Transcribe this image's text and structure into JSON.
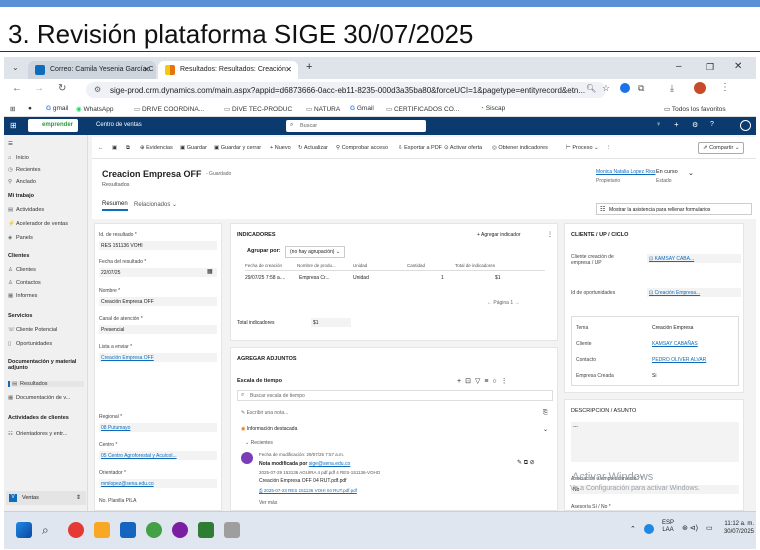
{
  "slide_title": "3. Revisión plataforma SIGE 30/07/2025",
  "browser": {
    "tabs": [
      {
        "label": "Correo: Camila Yesenia García C",
        "active": false
      },
      {
        "label": "Resultados: Resultados: Creación",
        "active": true
      }
    ],
    "new_tab": "+",
    "url": "sige-prod.crm.dynamics.com/main.aspx?appid=d6873666-0acc-eb11-8235-000d3a35ba80&forceUCI=1&pagetype=entityrecord&etn...",
    "bookmarks": [
      "gmail",
      "WhatsApp",
      "DRIVE COORDINA...",
      "DIVE TEC-PRODUC",
      "NATURA",
      "Gmail",
      "CERTIFICADOS CO...",
      "Siscap"
    ],
    "bookmarks_right": "Todos los favoritos"
  },
  "app": {
    "brand": "emprender",
    "area": "Centro de ventas",
    "search_placeholder": "Buscar"
  },
  "nav": {
    "top": [
      "Inicio",
      "Recientes",
      "Anclado"
    ],
    "section_work": "Mi trabajo",
    "work_items": [
      "Actividades",
      "Acelerador de ventas",
      "Panels"
    ],
    "section_clients": "Clientes",
    "client_items": [
      "Clientes",
      "Contactos",
      "Informes"
    ],
    "section_services": "Servicios",
    "service_items": [
      "Cliente Potencial",
      "Oportunidades"
    ],
    "section_docs": "Documentación y material adjunto",
    "doc_items": [
      "Resultados",
      "Documentación de v..."
    ],
    "section_activities": "Actividades de clientes",
    "activity_items": [
      "Orientadores y entr..."
    ],
    "area_switcher": "Ventas"
  },
  "commands": [
    "Evidencias",
    "Guardar",
    "Guardar y cerrar",
    "Nuevo",
    "Actualizar",
    "Comprobar acceso",
    "Exportar a PDF",
    "Activar oferta",
    "Obtener indicadores",
    "Proceso",
    "Compartir"
  ],
  "record": {
    "title": "Creacion Empresa OFF",
    "saved": "- Guardado",
    "entity": "Resultados",
    "tabs": [
      "Resumen",
      "Relacionados"
    ],
    "owner_name": "Monica Natalia Lopez Rios",
    "owner_label": "Propietario",
    "status": "En curso",
    "status_label": "Estado",
    "assist": "Mostrar la asistencia para rellenar formularios"
  },
  "form_left": {
    "fields": [
      {
        "label": "Id. de resultado *",
        "value": "RES 151136 VOHI"
      },
      {
        "label": "Fecha del resultado *",
        "value": "22/07/25"
      },
      {
        "label": "Nombre *",
        "value": "Creación Empresa OFF"
      },
      {
        "label": "Canal de atención *",
        "value": "Presencial"
      },
      {
        "label": "Lista a enviar *",
        "value": "Creación Empresa OFF"
      },
      {
        "label": "Regional *",
        "value": "08 Putumayo"
      },
      {
        "label": "Centro *",
        "value": "05 Centro Agroforestal y Acuícol..."
      },
      {
        "label": "Orientador *",
        "value": "mmlopez@sena.edu.co"
      },
      {
        "label": "No. Planilla PILA",
        "value": ""
      }
    ]
  },
  "indicators": {
    "title": "INDICADORES",
    "add": "Agregar indicador",
    "group_label": "Agrupar por:",
    "group_value": "(no hay agrupación)",
    "columns": [
      "Fecha de creación",
      "Nombre de produ...",
      "Unidad",
      "Cantidad",
      "Total de indicadores"
    ],
    "row": {
      "date": "29/07/25 7:58 a....",
      "name": "Empresa Cr...",
      "unit": "Unidad",
      "qty": "1",
      "total": "$1"
    },
    "pager": "Página 1",
    "total_label": "Total indicadores",
    "total_value": "$1"
  },
  "attachments": {
    "title": "AGREGAR ADJUNTOS",
    "timeline": "Escala de tiempo",
    "search": "Buscar escala de tiempo",
    "note_placeholder": "Escribir una nota...",
    "highlight": "Información destacada",
    "recent": "Recientes",
    "note_date": "Fecha de modificación: 29/07/25 7:57 a.m.",
    "note_title": "Nota modificada por",
    "note_author": "sige@sena.edu.co",
    "note_line1": "2025-07-29 153136 AGUIRA 4 pdf.pdf 4 RES-151136-VOHO",
    "note_line2": "Creación Empresa OFF 04 RUT.pdf.pdf",
    "note_file": "2025-07-23 RES 151136 VOHI 04 RUT.pdf.pdf",
    "more": "Ver más"
  },
  "side": {
    "title": "CLIENTE / UP / CICLO",
    "client_label": "Cliente creación de empresa / UP",
    "client_value": "KAMSAY CABA...",
    "opportunity_label": "Id de oportunidades",
    "opportunity_value": "Creación Empresa...",
    "rows": [
      {
        "label": "Tema",
        "value": "Creación Empresa"
      },
      {
        "label": "Cliente",
        "value": "KAMSAY CABAÑAS"
      },
      {
        "label": "Contacto",
        "value": "PEDRO OLIVER ALVAR"
      },
      {
        "label": "Empresa Creada",
        "value": "Si"
      }
    ],
    "desc_title": "DESCRIPCION / ASUNTO",
    "desc_value": "---",
    "assoc_label": "Asociación a emprendimiento? *",
    "assoc_value": "No",
    "last_label": "Asesoría Sí / No *"
  },
  "windows": {
    "activate_title": "Activar Windows",
    "activate_sub": "Ve a Configuración para activar Windows.",
    "lang1": "ESP",
    "lang2": "LAA",
    "time": "11:12 a. m.",
    "date": "30/07/2025"
  },
  "colors": {
    "d365_header": "#0b3a6e",
    "link": "#0f6cbd",
    "accent": "#5b8fd6"
  }
}
